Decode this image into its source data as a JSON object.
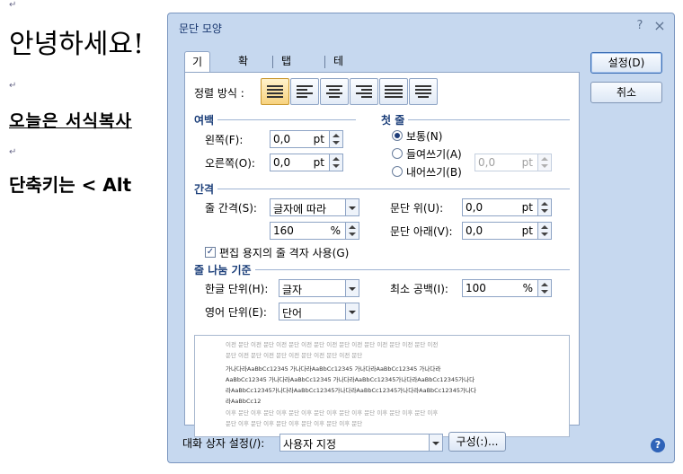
{
  "document": {
    "line1": "안녕하세요!",
    "line2": "오늘은  서식복사  ",
    "line3": "단축키는 < Alt "
  },
  "dialog": {
    "title": "문단 모양",
    "help_glyph": "?",
    "close_glyph": "×",
    "tabs": [
      "기본",
      "확장",
      "탭 설정",
      "테두리/배경"
    ],
    "buttons": {
      "ok": "설정(D)",
      "cancel": "취소"
    },
    "alignment": {
      "label": "정렬 방식 :",
      "selected": "justify"
    },
    "margin": {
      "header": "여백",
      "left_label": "왼쪽(F):",
      "left_value": "0,0",
      "left_unit": "pt",
      "right_label": "오른쪽(O):",
      "right_value": "0,0",
      "right_unit": "pt"
    },
    "first_line": {
      "header": "첫 줄",
      "options": [
        "보통(N)",
        "들여쓰기(A)",
        "내어쓰기(B)"
      ],
      "selected_index": 0,
      "value": "0,0",
      "unit": "pt"
    },
    "spacing": {
      "header": "간격",
      "line_label": "줄 간격(S):",
      "line_type": "글자에 따라",
      "line_value": "160",
      "line_unit": "%",
      "above_label": "문단 위(U):",
      "above_value": "0,0",
      "above_unit": "pt",
      "below_label": "문단 아래(V):",
      "below_value": "0,0",
      "below_unit": "pt",
      "grid_checkbox": "편집 용지의 줄 격자 사용(G)",
      "grid_checked": true
    },
    "line_break": {
      "header": "줄 나눔 기준",
      "korean_label": "한글 단위(H):",
      "korean_value": "글자",
      "english_label": "영어 단위(E):",
      "english_value": "단어",
      "min_space_label": "최소 공백(I):",
      "min_space_value": "100",
      "min_space_unit": "%"
    },
    "preview": {
      "lines": [
        "이전 문단 이전 문단 이전 문단 이전 문단 이전 문단 이전 문단 이전 문단 이전 문단 이전",
        "문단 이전 문단 이전 문단 이전 문단 이전 문단 이전 문단",
        "가나다라AaBbCc12345      가나다라AaBbCc12345      가나다라AaBbCc12345      가나다라",
        "AaBbCc12345 가나다라AaBbCc12345 가나다라AaBbCc12345가나다라AaBbCc12345가나다",
        "라AaBbCc12345가나다라AaBbCc12345가나다라AaBbCc12345가나다라AaBbCc12345가나다",
        "라AaBbCc12",
        "이후 문단 이후 문단 이후 문단 이후 문단 이후 문단 이후 문단 이후 문단 이후 문단 이후",
        "문단 이후 문단 이후 문단 이후 문단 이후 문단 이후 문단"
      ]
    },
    "footer": {
      "label": "대화 상자 설정(/):",
      "value": "사용자 지정",
      "config_button": "구성(:)..."
    }
  }
}
